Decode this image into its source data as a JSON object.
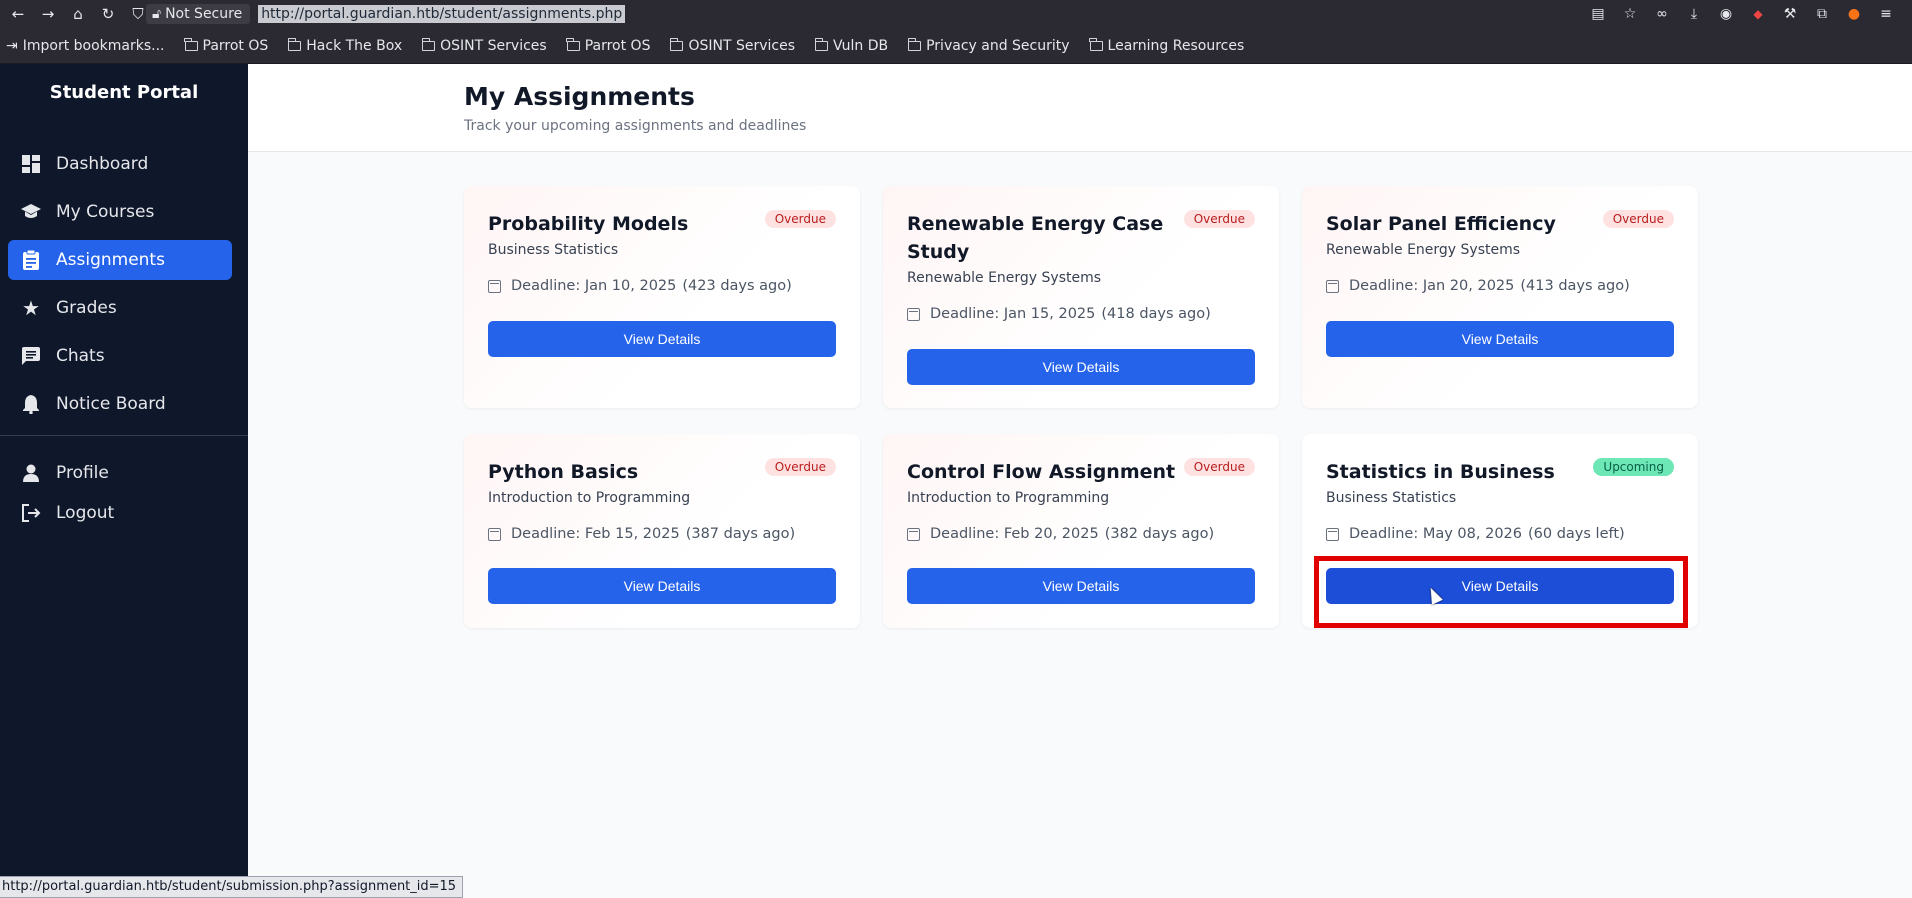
{
  "browser": {
    "not_secure": "Not Secure",
    "url": "http://portal.guardian.htb/student/assignments.php",
    "bookmarks": [
      {
        "label": "Import bookmarks..."
      },
      {
        "label": "Parrot OS"
      },
      {
        "label": "Hack The Box"
      },
      {
        "label": "OSINT Services"
      },
      {
        "label": "Parrot OS"
      },
      {
        "label": "OSINT Services"
      },
      {
        "label": "Vuln DB"
      },
      {
        "label": "Privacy and Security"
      },
      {
        "label": "Learning Resources"
      }
    ],
    "status_url": "http://portal.guardian.htb/student/submission.php?assignment_id=15"
  },
  "sidebar": {
    "brand": "Student Portal",
    "items": [
      {
        "label": "Dashboard",
        "icon": "dashboard-icon"
      },
      {
        "label": "My Courses",
        "icon": "graduation-cap-icon"
      },
      {
        "label": "Assignments",
        "icon": "clipboard-icon",
        "active": true
      },
      {
        "label": "Grades",
        "icon": "star-icon"
      },
      {
        "label": "Chats",
        "icon": "chat-icon"
      },
      {
        "label": "Notice Board",
        "icon": "bell-icon"
      },
      {
        "label": "Profile",
        "icon": "person-icon"
      },
      {
        "label": "Logout",
        "icon": "logout-icon"
      }
    ]
  },
  "header": {
    "title": "My Assignments",
    "subtitle": "Track your upcoming assignments and deadlines"
  },
  "assignments": [
    {
      "title": "Probability Models",
      "status": "Overdue",
      "course": "Business Statistics",
      "deadline": "Deadline: Jan 10, 2025",
      "relative": "(423 days ago)",
      "button": "View Details"
    },
    {
      "title": "Renewable Energy Case Study",
      "status": "Overdue",
      "course": "Renewable Energy Systems",
      "deadline": "Deadline: Jan 15, 2025",
      "relative": "(418 days ago)",
      "button": "View Details"
    },
    {
      "title": "Solar Panel Efficiency",
      "status": "Overdue",
      "course": "Renewable Energy Systems",
      "deadline": "Deadline: Jan 20, 2025",
      "relative": "(413 days ago)",
      "button": "View Details"
    },
    {
      "title": "Python Basics",
      "status": "Overdue",
      "course": "Introduction to Programming",
      "deadline": "Deadline: Feb 15, 2025",
      "relative": "(387 days ago)",
      "button": "View Details"
    },
    {
      "title": "Control Flow Assignment",
      "status": "Overdue",
      "course": "Introduction to Programming",
      "deadline": "Deadline: Feb 20, 2025",
      "relative": "(382 days ago)",
      "button": "View Details"
    },
    {
      "title": "Statistics in Business",
      "status": "Upcoming",
      "course": "Business Statistics",
      "deadline": "Deadline: May 08, 2026",
      "relative": "(60 days left)",
      "button": "View Details"
    }
  ],
  "colors": {
    "sidebar_bg": "#0f172a",
    "accent": "#2563eb",
    "overdue_badge": "#fee2e2",
    "upcoming_badge": "#6ee7b7",
    "highlight": "#e00000"
  }
}
